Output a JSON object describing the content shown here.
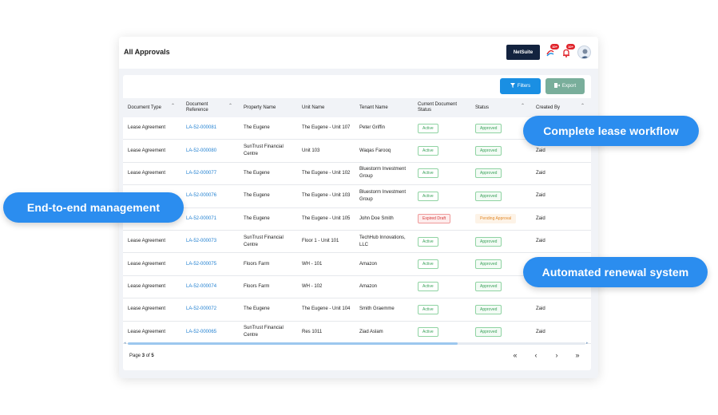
{
  "header": {
    "title": "All Approvals",
    "netsuite_label": "NetSuite",
    "notif_badge_1": "10+",
    "notif_badge_2": "10+"
  },
  "toolbar": {
    "filters_label": "Filters",
    "export_label": "Export"
  },
  "table": {
    "columns": [
      "Document Type",
      "Document Reference",
      "Property Name",
      "Unit Name",
      "Tenant Name",
      "Current Document Status",
      "Status",
      "Created By"
    ],
    "rows": [
      {
        "doc_type": "Lease Agreement",
        "doc_ref": "LA-52-000081",
        "property": "The Eugene",
        "unit": "The Eugene - Unit 107",
        "tenant": "Peter Griffin",
        "current_status": "Active",
        "status": "Approved",
        "created_by": ""
      },
      {
        "doc_type": "Lease Agreement",
        "doc_ref": "LA-52-000080",
        "property": "SunTrust Financial Centre",
        "unit": "Unit 103",
        "tenant": "Waqas Farooq",
        "current_status": "Active",
        "status": "Approved",
        "created_by": "Zaid"
      },
      {
        "doc_type": "Lease Agreement",
        "doc_ref": "LA-52-000077",
        "property": "The Eugene",
        "unit": "The Eugene - Unit 102",
        "tenant": "Bluestorm Investment Group",
        "current_status": "Active",
        "status": "Approved",
        "created_by": "Zaid"
      },
      {
        "doc_type": "",
        "doc_ref": "LA-52-000076",
        "property": "The Eugene",
        "unit": "The Eugene - Unit 103",
        "tenant": "Bluestorm Investment Group",
        "current_status": "Active",
        "status": "Approved",
        "created_by": "Zaid"
      },
      {
        "doc_type": "",
        "doc_ref": "LA-52-000071",
        "property": "The Eugene",
        "unit": "The Eugene - Unit 105",
        "tenant": "John Doe Smith",
        "current_status": "Expired Draft",
        "status": "Pending Approval",
        "created_by": "Zaid"
      },
      {
        "doc_type": "Lease Agreement",
        "doc_ref": "LA-52-000073",
        "property": "SunTrust Financial Centre",
        "unit": "Floor 1 - Unit 101",
        "tenant": "TechHub Innovations, LLC",
        "current_status": "Active",
        "status": "Approved",
        "created_by": "Zaid"
      },
      {
        "doc_type": "Lease Agreement",
        "doc_ref": "LA-52-000075",
        "property": "Floors Farm",
        "unit": "WH - 101",
        "tenant": "Amazon",
        "current_status": "Active",
        "status": "Approved",
        "created_by": ""
      },
      {
        "doc_type": "Lease Agreement",
        "doc_ref": "LA-52-000074",
        "property": "Floors Farm",
        "unit": "WH - 102",
        "tenant": "Amazon",
        "current_status": "Active",
        "status": "Approved",
        "created_by": ""
      },
      {
        "doc_type": "Lease Agreement",
        "doc_ref": "LA-52-000072",
        "property": "The Eugene",
        "unit": "The Eugene - Unit 104",
        "tenant": "Smith Graemme",
        "current_status": "Active",
        "status": "Approved",
        "created_by": "Zaid"
      },
      {
        "doc_type": "Lease Agreement",
        "doc_ref": "LA-52-000065",
        "property": "SunTrust Financial Centre",
        "unit": "Res 1011",
        "tenant": "Ziad Aslam",
        "current_status": "Active",
        "status": "Approved",
        "created_by": "Zaid"
      }
    ]
  },
  "pagination": {
    "label_prefix": "Page ",
    "current": "3",
    "label_mid": " of ",
    "total": "5",
    "first": "«",
    "prev": "‹",
    "next": "›",
    "last": "»"
  },
  "callouts": {
    "workflow": "Complete lease workflow",
    "management": "End-to-end management",
    "renewal": "Automated renewal system"
  },
  "colors": {
    "accent": "#2b8def",
    "netsuite_bg": "#13233f",
    "filters_bg": "#1a8fe3",
    "export_bg": "#79ae9b",
    "active_green": "#3aa25a",
    "expired_red": "#d63a3a",
    "pending_orange": "#e38a2b"
  },
  "icons": {
    "filters": "filter-icon",
    "export": "export-icon",
    "notification": "bell-icon",
    "avatar": "user-avatar"
  },
  "scroll": {
    "horizontal_fraction": 0.72
  }
}
